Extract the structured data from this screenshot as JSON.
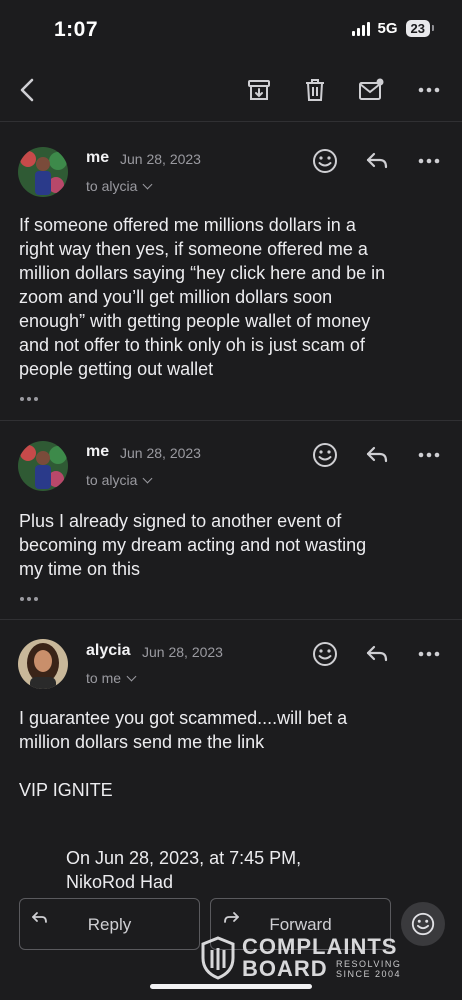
{
  "status_bar": {
    "time": "1:07",
    "network": "5G",
    "battery": "23"
  },
  "toolbar": {
    "icons": [
      "chevron-left-icon",
      "archive-icon",
      "trash-icon",
      "mail-icon",
      "more-horizontal-icon"
    ]
  },
  "messages": [
    {
      "sender": "me",
      "date": "Jun 28, 2023",
      "recipient": "to alycia",
      "body": "If someone offered me millions dollars in a\nright way then yes, if someone offered me a\nmillion dollars saying “hey click here and be in\nzoom and you’ll get million dollars soon\nenough” with getting people wallet of money\nand not offer to think only oh is just scam of\npeople getting out wallet"
    },
    {
      "sender": "me",
      "date": "Jun 28, 2023",
      "recipient": "to alycia",
      "body": "Plus I already signed to another event of\nbecoming my dream acting and not wasting\nmy time on this"
    },
    {
      "sender": "alycia",
      "date": "Jun 28, 2023",
      "recipient": "to me",
      "body": "I guarantee you got scammed....will bet a\nmillion dollars send me the link\n\nVIP IGNITE",
      "quote_intro": "On Jun 28, 2023, at 7:45 PM,\nNikoRod Had"
    }
  ],
  "actions": {
    "reply_label": "Reply",
    "forward_label": "Forward"
  },
  "watermark": {
    "line1": "COMPLAINTS",
    "line2": "BOARD",
    "tagline": "RESOLVING\nSINCE 2004"
  },
  "colors": {
    "background": "#1c1c1e",
    "text": "#ececef",
    "muted": "#9a9aa0",
    "divider": "#303033"
  }
}
